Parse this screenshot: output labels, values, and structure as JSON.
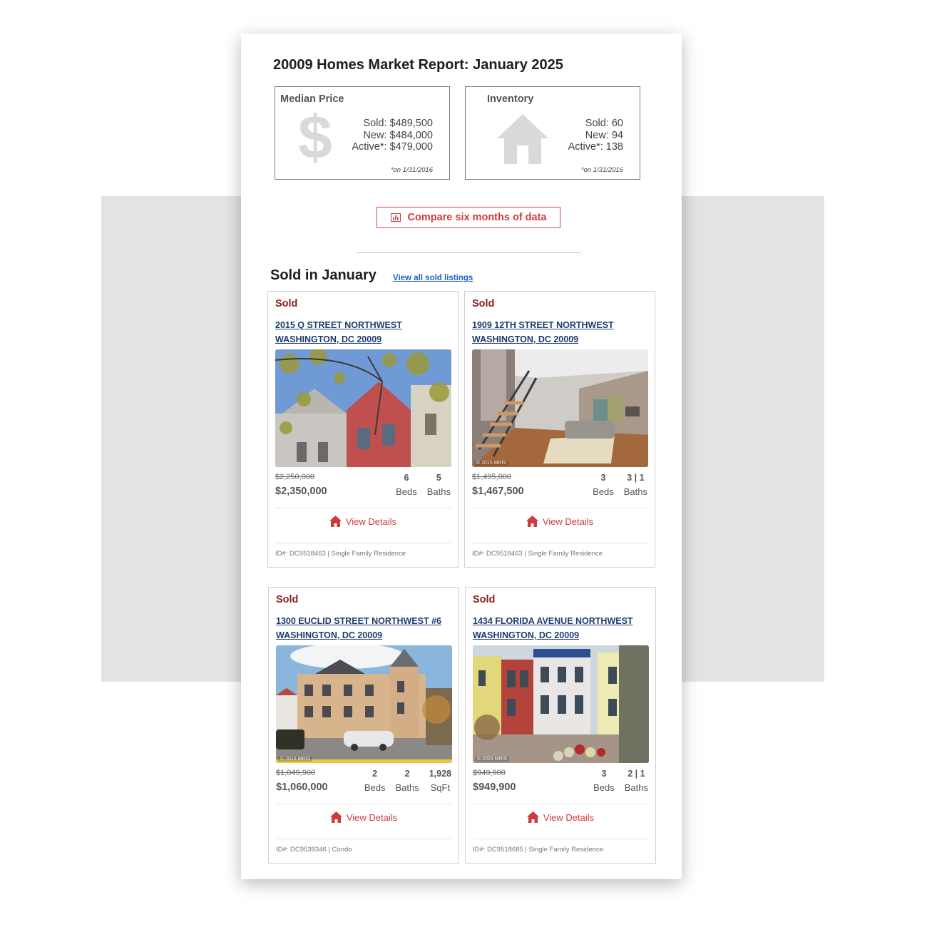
{
  "report": {
    "title": "20009 Homes Market Report: January 2025",
    "median_price": {
      "label": "Median Price",
      "icon": "dollar-icon",
      "lines": [
        "Sold: $489,500",
        "New: $484,000",
        "Active*: $479,000"
      ],
      "footnote": "*on 1/31/2016"
    },
    "inventory": {
      "label": "Inventory",
      "icon": "house-icon",
      "lines": [
        "Sold: 60",
        "New: 94",
        "Active*: 138"
      ],
      "footnote": "*on 1/31/2016"
    },
    "compare_button": {
      "icon": "bar-chart-icon",
      "label": "Compare six months of data"
    }
  },
  "sold_section": {
    "title": "Sold in January",
    "view_all_link": "View all sold listings",
    "listings": [
      {
        "status": "Sold",
        "address_line1": "2015 Q STREET NORTHWEST",
        "address_line2": "WASHINGTON, DC 20009",
        "photo": "Red brick rowhouse framed by autumn tree branches",
        "watermark": "",
        "original_price": "$2,250,000",
        "price": "$2,350,000",
        "specs": [
          {
            "value": "6",
            "unit": "Beds"
          },
          {
            "value": "5",
            "unit": "Baths"
          }
        ],
        "details_label": "View Details",
        "meta": "ID#: DC9518463 | Single Family Residence"
      },
      {
        "status": "Sold",
        "address_line1": "1909 12TH STREET NORTHWEST",
        "address_line2": "WASHINGTON, DC 20009",
        "photo": "Modern living room with open staircase",
        "watermark": "© 2015 MRIS",
        "original_price": "$1,495,000",
        "price": "$1,467,500",
        "specs": [
          {
            "value": "3",
            "unit": "Beds"
          },
          {
            "value": "3 | 1",
            "unit": "Baths"
          }
        ],
        "details_label": "View Details",
        "meta": "ID#: DC9518463 | Single Family Residence"
      },
      {
        "status": "Sold",
        "address_line1": "1300 EUCLID STREET NORTHWEST #6",
        "address_line2": "WASHINGTON, DC 20009",
        "photo": "Tan stone condo building with turret",
        "watermark": "© 2015 MRIS",
        "original_price": "$1,049,900",
        "price": "$1,060,000",
        "specs": [
          {
            "value": "2",
            "unit": "Beds"
          },
          {
            "value": "2",
            "unit": "Baths"
          },
          {
            "value": "1,928",
            "unit": "SqFt"
          }
        ],
        "details_label": "View Details",
        "meta": "ID#: DC9539346 | Condo"
      },
      {
        "status": "Sold",
        "address_line1": "1434 FLORIDA AVENUE NORTHWEST",
        "address_line2": "WASHINGTON, DC 20009",
        "photo": "Row of colorful townhouses with flower bed",
        "watermark": "© 2015 MRIS",
        "original_price": "$949,900",
        "price": "$949,900",
        "specs": [
          {
            "value": "3",
            "unit": "Beds"
          },
          {
            "value": "2 | 1",
            "unit": "Baths"
          }
        ],
        "details_label": "View Details",
        "meta": "ID#: DC9518685 | Single Family Residence"
      }
    ]
  }
}
